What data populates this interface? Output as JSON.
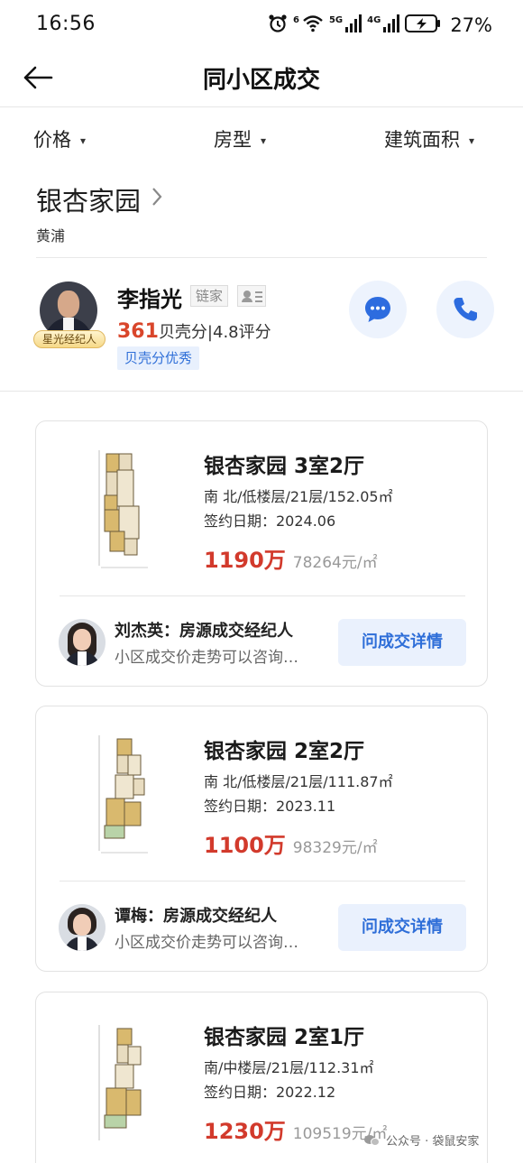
{
  "status_bar": {
    "time": "16:56",
    "net_1": "6",
    "net_2": "5G",
    "net_3": "4G",
    "battery": "27%",
    "icons": [
      "alarm-icon",
      "wifi-icon",
      "signal-icon",
      "signal-icon",
      "battery-charging-icon"
    ]
  },
  "header": {
    "title": "同小区成交",
    "back_icon": "arrow-left-icon"
  },
  "filters": [
    {
      "label": "价格"
    },
    {
      "label": "房型"
    },
    {
      "label": "建筑面积"
    }
  ],
  "community": {
    "name": "银杏家园",
    "district": "黄浦"
  },
  "agent": {
    "name": "李指光",
    "brand": "链家",
    "badge": "星光经纪人",
    "score": "361",
    "score_text": "贝壳分|4.8评分",
    "tag": "贝壳分优秀"
  },
  "deals": [
    {
      "title": "银杏家园 3室2厅",
      "spec": "南 北/低楼层/21层/152.05㎡",
      "date": "签约日期：2024.06",
      "price": "1190万",
      "unit_price": "78264元/㎡",
      "broker_name": "刘杰英：房源成交经纪人",
      "broker_desc": "小区成交价走势可以咨询…",
      "button": "问成交详情"
    },
    {
      "title": "银杏家园 2室2厅",
      "spec": "南 北/低楼层/21层/111.87㎡",
      "date": "签约日期：2023.11",
      "price": "1100万",
      "unit_price": "98329元/㎡",
      "broker_name": "谭梅：房源成交经纪人",
      "broker_desc": "小区成交价走势可以咨询…",
      "button": "问成交详情"
    },
    {
      "title": "银杏家园 2室1厅",
      "spec": "南/中楼层/21层/112.31㎡",
      "date": "签约日期：2022.12",
      "price": "1230万",
      "unit_price": "109519元/㎡"
    }
  ],
  "watermark": "公众号 · 袋鼠安家",
  "colors": {
    "accent_blue": "#2e6ed8",
    "price_red": "#d23a2c",
    "button_bg": "#eaf1fd"
  }
}
